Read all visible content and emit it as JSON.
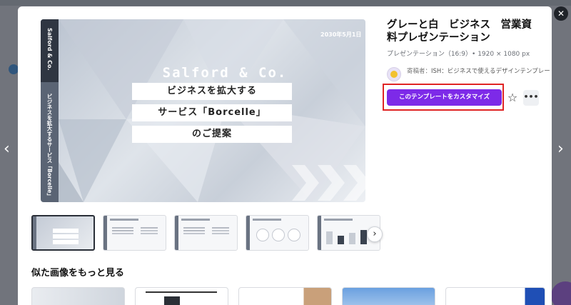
{
  "modal": {
    "title": "グレーと白　ビジネス　営業資料プレゼンテーション",
    "meta": "プレゼンテーション（16:9）• 1920 × 1080 px",
    "author_label": "寄稿者：",
    "author_name": "ISH：ビジネスで使えるデザインテンプレート",
    "customize_label": "このテンプレートをカスタマイズ",
    "similar_title": "似た画像をもっと見る",
    "accent_color": "#7d2ae8",
    "highlight_color": "#e02424"
  },
  "slide": {
    "vertical_top": "Salford & Co.",
    "vertical_bottom": "ビジネスを拡大するサービス「Borcelle」",
    "date": "2030年5月1日",
    "company": "Salford & Co.",
    "line1": "ビジネスを拡大する",
    "line2": "サービス「Borcelle」",
    "line3": "のご提案"
  },
  "icons": {
    "close": "✕",
    "prev": "‹",
    "next": "›",
    "star": "☆",
    "more": "•••",
    "thumbs_next": "›"
  }
}
